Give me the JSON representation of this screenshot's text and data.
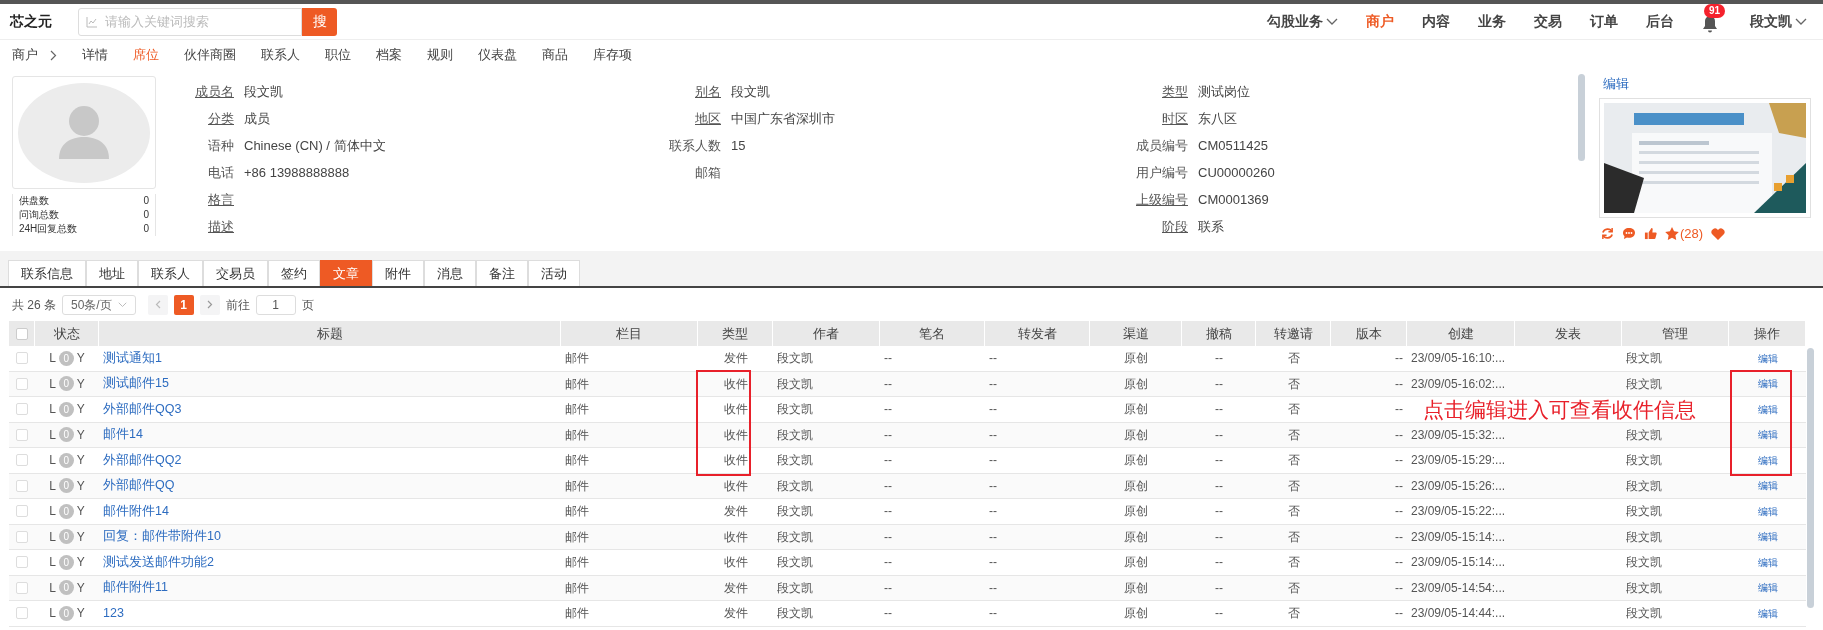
{
  "header": {
    "logo": "芯之元",
    "search": {
      "placeholder": "请输入关键词搜索",
      "button": "搜"
    },
    "nav": [
      {
        "label": "勾股业务",
        "dropdown": true,
        "selected": false
      },
      {
        "label": "商户",
        "dropdown": false,
        "selected": true
      },
      {
        "label": "内容",
        "dropdown": false,
        "selected": false
      },
      {
        "label": "业务",
        "dropdown": false,
        "selected": false
      },
      {
        "label": "交易",
        "dropdown": false,
        "selected": false
      },
      {
        "label": "订单",
        "dropdown": false,
        "selected": false
      },
      {
        "label": "后台",
        "dropdown": false,
        "selected": false
      }
    ],
    "notifications": "91",
    "user": "段文凯"
  },
  "breadcrumb": {
    "root": "商户",
    "items": [
      {
        "label": "详情",
        "selected": false
      },
      {
        "label": "席位",
        "selected": true
      },
      {
        "label": "伙伴商圈",
        "selected": false
      },
      {
        "label": "联系人",
        "selected": false
      },
      {
        "label": "职位",
        "selected": false
      },
      {
        "label": "档案",
        "selected": false
      },
      {
        "label": "规则",
        "selected": false
      },
      {
        "label": "仪表盘",
        "selected": false
      },
      {
        "label": "商品",
        "selected": false
      },
      {
        "label": "库存项",
        "selected": false
      }
    ]
  },
  "profile": {
    "stats": [
      {
        "label": "供盘数",
        "value": "0"
      },
      {
        "label": "问询总数",
        "value": "0"
      },
      {
        "label": "24H回复总数",
        "value": "0"
      }
    ],
    "columns": [
      [
        {
          "label": "成员名",
          "value": "段文凯",
          "underlined": true
        },
        {
          "label": "分类",
          "value": "成员",
          "underlined": true
        },
        {
          "label": "语种",
          "value": "Chinese (CN) / 简体中文",
          "underlined": false
        },
        {
          "label": "电话",
          "value": "+86 13988888888",
          "underlined": false
        },
        {
          "label": "格言",
          "underlined": true
        },
        {
          "label": "描述",
          "underlined": true
        }
      ],
      [
        {
          "label": "别名",
          "value": "段文凯",
          "underlined": true
        },
        {
          "label": "地区",
          "value": "中国广东省深圳市",
          "underlined": true
        },
        {
          "label": "联系人数",
          "value": "15",
          "underlined": false
        },
        {
          "label": "邮箱",
          "underlined": false
        }
      ],
      [
        {
          "label": "类型",
          "value": "测试岗位",
          "underlined": true
        },
        {
          "label": "时区",
          "value": "东八区",
          "underlined": true
        },
        {
          "label": "成员编号",
          "value": "CM0511425",
          "underlined": false
        },
        {
          "label": "用户编号",
          "value": "CU00000260",
          "underlined": false
        },
        {
          "label": "上级编号",
          "value": "CM0001369",
          "underlined": true
        },
        {
          "label": "阶段",
          "value": "联系",
          "underlined": true
        }
      ]
    ],
    "edit_link": "编辑",
    "image": {
      "kind": "picture"
    },
    "stars_count": "(28)"
  },
  "tabs": [
    {
      "label": "联系信息",
      "selected": false
    },
    {
      "label": "地址",
      "selected": false
    },
    {
      "label": "联系人",
      "selected": false
    },
    {
      "label": "交易员",
      "selected": false
    },
    {
      "label": "签约",
      "selected": false
    },
    {
      "label": "文章",
      "selected": true
    },
    {
      "label": "附件",
      "selected": false
    },
    {
      "label": "消息",
      "selected": false
    },
    {
      "label": "备注",
      "selected": false
    },
    {
      "label": "活动",
      "selected": false
    }
  ],
  "pagination": {
    "total_prefix": "共",
    "total": "26",
    "total_suffix": "条",
    "page_size": "50条/页",
    "current_page": "1",
    "goto_label": "前往",
    "goto_value": "1",
    "goto_suffix": "页"
  },
  "table": {
    "all_checked": false,
    "columns": [
      "状态",
      "标题",
      "栏目",
      "类型",
      "作者",
      "笔名",
      "转发者",
      "渠道",
      "撤稿",
      "转邀请",
      "版本",
      "创建",
      "发表",
      "管理",
      "操作"
    ],
    "rows": [
      {
        "checked": false,
        "highlighted": false,
        "status": [
          "L",
          "0",
          "Y"
        ],
        "title": "测试通知1",
        "section": "邮件",
        "type": "发件",
        "author": "段文凯",
        "pen_name": "--",
        "forwarder": "--",
        "channel": "原创",
        "withdrawn": "--",
        "reinvite": "否",
        "version": "--",
        "created": "23/09/05-16:10:...",
        "manager": "段文凯",
        "action": "编辑"
      },
      {
        "checked": false,
        "highlighted": true,
        "status": [
          "L",
          "0",
          "Y"
        ],
        "title": "测试邮件15",
        "section": "邮件",
        "type": "收件",
        "author": "段文凯",
        "pen_name": "--",
        "forwarder": "--",
        "channel": "原创",
        "withdrawn": "--",
        "reinvite": "否",
        "version": "--",
        "created": "23/09/05-16:02:...",
        "manager": "段文凯",
        "action": "编辑"
      },
      {
        "checked": false,
        "highlighted": true,
        "status": [
          "L",
          "0",
          "Y"
        ],
        "title": "外部邮件QQ3",
        "section": "邮件",
        "type": "收件",
        "author": "段文凯",
        "pen_name": "--",
        "forwarder": "--",
        "channel": "原创",
        "withdrawn": "--",
        "reinvite": "否",
        "version": "--",
        "action": "编辑"
      },
      {
        "checked": false,
        "highlighted": true,
        "status": [
          "L",
          "0",
          "Y"
        ],
        "title": "邮件14",
        "section": "邮件",
        "type": "收件",
        "author": "段文凯",
        "pen_name": "--",
        "forwarder": "--",
        "channel": "原创",
        "withdrawn": "--",
        "reinvite": "否",
        "version": "--",
        "created": "23/09/05-15:32:...",
        "manager": "段文凯",
        "action": "编辑"
      },
      {
        "checked": false,
        "highlighted": true,
        "status": [
          "L",
          "0",
          "Y"
        ],
        "title": "外部邮件QQ2",
        "section": "邮件",
        "type": "收件",
        "author": "段文凯",
        "pen_name": "--",
        "forwarder": "--",
        "channel": "原创",
        "withdrawn": "--",
        "reinvite": "否",
        "version": "--",
        "created": "23/09/05-15:29:...",
        "manager": "段文凯",
        "action": "编辑"
      },
      {
        "checked": false,
        "highlighted": false,
        "status": [
          "L",
          "0",
          "Y"
        ],
        "title": "外部邮件QQ",
        "section": "邮件",
        "type": "收件",
        "author": "段文凯",
        "pen_name": "--",
        "forwarder": "--",
        "channel": "原创",
        "withdrawn": "--",
        "reinvite": "否",
        "version": "--",
        "created": "23/09/05-15:26:...",
        "manager": "段文凯",
        "action": "编辑"
      },
      {
        "checked": false,
        "highlighted": false,
        "status": [
          "L",
          "0",
          "Y"
        ],
        "title": "邮件附件14",
        "section": "邮件",
        "type": "发件",
        "author": "段文凯",
        "pen_name": "--",
        "forwarder": "--",
        "channel": "原创",
        "withdrawn": "--",
        "reinvite": "否",
        "version": "--",
        "created": "23/09/05-15:22:...",
        "manager": "段文凯",
        "action": "编辑"
      },
      {
        "checked": false,
        "highlighted": false,
        "status": [
          "L",
          "0",
          "Y"
        ],
        "title": "回复：邮件带附件10",
        "section": "邮件",
        "type": "收件",
        "author": "段文凯",
        "pen_name": "--",
        "forwarder": "--",
        "channel": "原创",
        "withdrawn": "--",
        "reinvite": "否",
        "version": "--",
        "created": "23/09/05-15:14:...",
        "manager": "段文凯",
        "action": "编辑"
      },
      {
        "checked": false,
        "highlighted": false,
        "status": [
          "L",
          "0",
          "Y"
        ],
        "title": "测试发送邮件功能2",
        "section": "邮件",
        "type": "收件",
        "author": "段文凯",
        "pen_name": "--",
        "forwarder": "--",
        "channel": "原创",
        "withdrawn": "--",
        "reinvite": "否",
        "version": "--",
        "created": "23/09/05-15:14:...",
        "manager": "段文凯",
        "action": "编辑"
      },
      {
        "checked": false,
        "highlighted": false,
        "status": [
          "L",
          "0",
          "Y"
        ],
        "title": "邮件附件11",
        "section": "邮件",
        "type": "发件",
        "author": "段文凯",
        "pen_name": "--",
        "forwarder": "--",
        "channel": "原创",
        "withdrawn": "--",
        "reinvite": "否",
        "version": "--",
        "created": "23/09/05-14:54:...",
        "manager": "段文凯",
        "action": "编辑"
      },
      {
        "checked": false,
        "highlighted": false,
        "status": [
          "L",
          "0",
          "Y"
        ],
        "title": "123",
        "section": "邮件",
        "type": "发件",
        "author": "段文凯",
        "pen_name": "--",
        "forwarder": "--",
        "channel": "原创",
        "withdrawn": "--",
        "reinvite": "否",
        "version": "--",
        "created": "23/09/05-14:44:...",
        "manager": "段文凯",
        "action": "编辑"
      }
    ]
  },
  "annotation": {
    "text": "点击编辑进入可查看收件信息"
  }
}
